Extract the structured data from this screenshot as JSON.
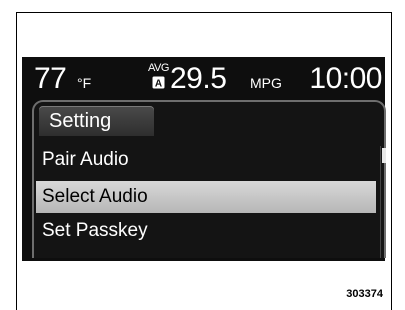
{
  "status": {
    "temperature": "77",
    "temperature_unit": "°F",
    "avg_label": "AVG",
    "fuel_icon": "fuel-gauge-a-icon",
    "fuel_economy": "29.5",
    "fuel_unit": "MPG",
    "time": "10:00"
  },
  "menu": {
    "title": "Setting",
    "items": [
      {
        "label": "Pair Audio",
        "selected": false
      },
      {
        "label": "Select Audio",
        "selected": true
      },
      {
        "label": "Set Passkey",
        "selected": false
      }
    ],
    "scroll_position": 0
  },
  "figure_id": "303374",
  "colors": {
    "screen_bg": "#0e0e0e",
    "highlight": "#c8c8c8",
    "text": "#ffffff"
  }
}
